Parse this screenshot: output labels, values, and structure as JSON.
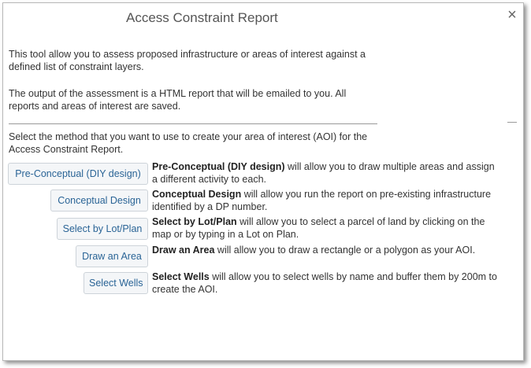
{
  "dialog": {
    "title": "Access Constraint Report",
    "close_label": "×"
  },
  "intro": {
    "paragraph1": "This tool allow you to assess proposed infrastructure or areas of interest against a defined list of constraint layers.",
    "paragraph2": "The output of the assessment is a HTML report that will be emailed to you. All reports and areas of interest are saved.",
    "paragraph3": "Select the method that you want to use to create your area of interest (AOI) for the Access Constraint Report."
  },
  "methods": [
    {
      "button_label": "Pre-Conceptual (DIY design)",
      "desc_title": "Pre-Conceptual (DIY design)",
      "desc_text": " will allow you to draw multiple areas and assign a different activity to each."
    },
    {
      "button_label": "Conceptual Design",
      "desc_title": "Conceptual Design",
      "desc_text": " will allow you run the report on pre-existing infrastructure identified by a DP number."
    },
    {
      "button_label": "Select by Lot/Plan",
      "desc_title": "Select by Lot/Plan",
      "desc_text": " will allow you to select a parcel of land by clicking on the map or by typing in a Lot on Plan."
    },
    {
      "button_label": "Draw an Area",
      "desc_title": "Draw an Area",
      "desc_text": " will allow you to draw a rectangle or a polygon as your AOI."
    },
    {
      "button_label": "Select Wells",
      "desc_title": "Select Wells",
      "desc_text": " will allow you to select wells by name and buffer them by 200m to create the AOI."
    }
  ]
}
